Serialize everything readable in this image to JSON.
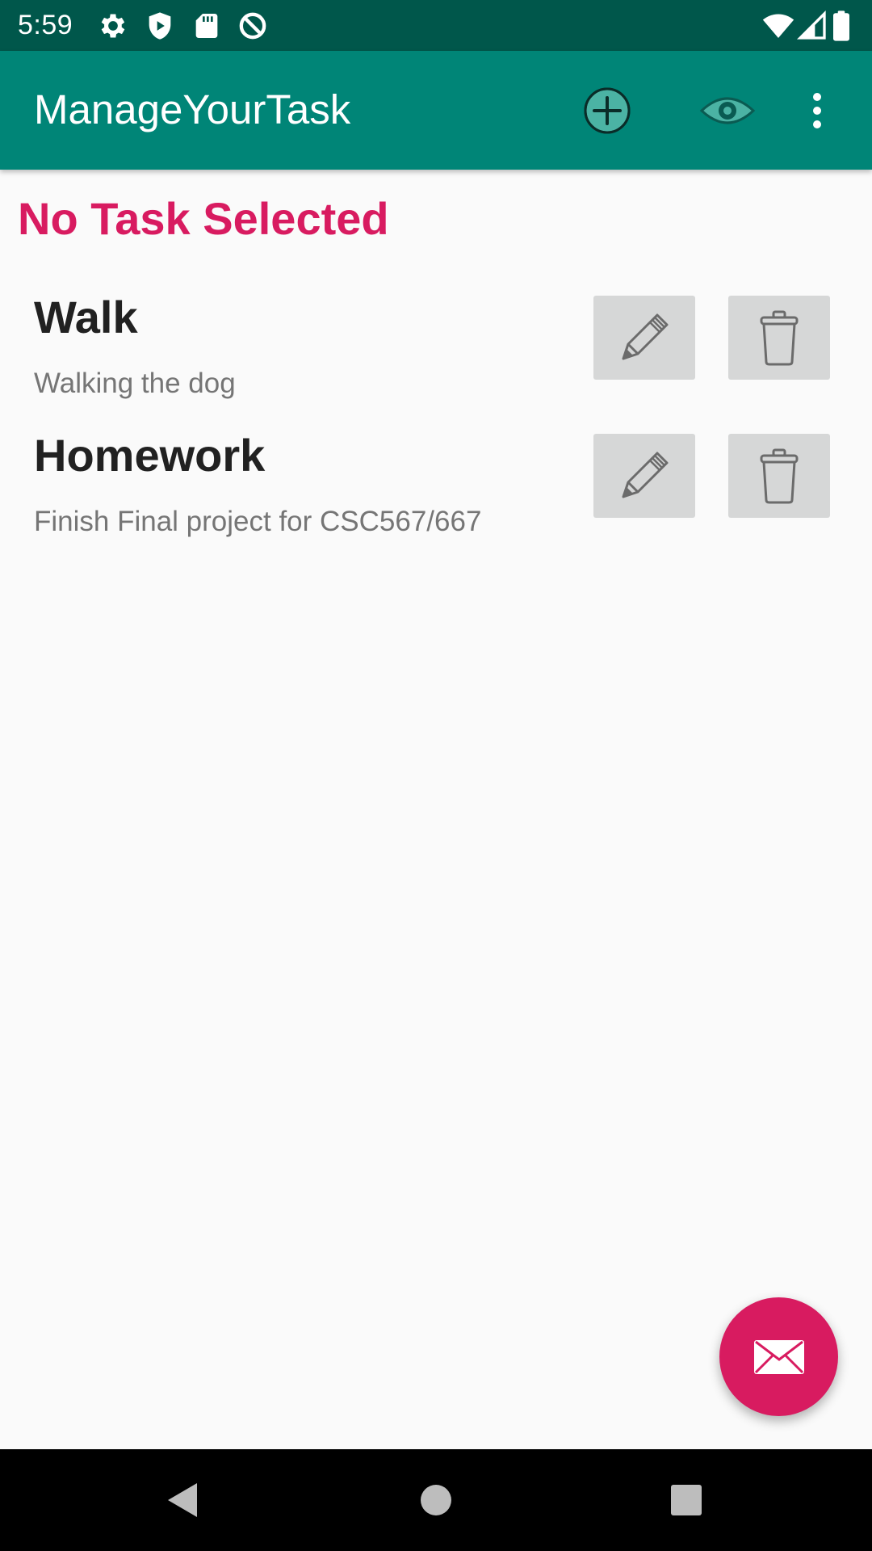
{
  "status_bar": {
    "time": "5:59",
    "icons": [
      "settings-icon",
      "shield-play-icon",
      "sd-card-icon",
      "data-saver-icon",
      "wifi-icon",
      "cell-signal-icon",
      "battery-icon"
    ]
  },
  "app_bar": {
    "title": "ManageYourTask",
    "actions": [
      "add-circle-icon",
      "eye-icon",
      "overflow-menu-icon"
    ]
  },
  "main": {
    "selection_heading": "No Task Selected",
    "tasks": [
      {
        "title": "Walk",
        "description": "Walking the dog"
      },
      {
        "title": "Homework",
        "description": "Finish Final project for CSC567/667"
      }
    ]
  },
  "fab": {
    "icon": "mail-icon"
  },
  "colors": {
    "status_bar": "#00574b",
    "app_bar": "#008577",
    "accent": "#d81b60",
    "task_title": "#212121",
    "task_desc": "#757575",
    "button_bg": "#d6d7d7"
  }
}
